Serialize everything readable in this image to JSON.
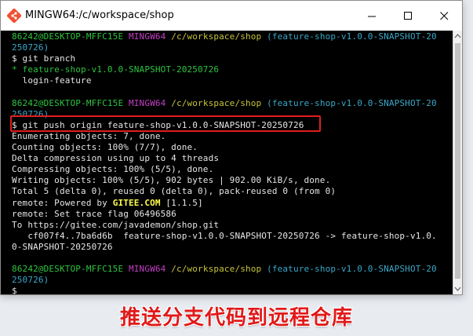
{
  "window": {
    "title": "MINGW64:/c/workspace/shop",
    "icon": "git-bash-icon",
    "controls": [
      "minimize-icon",
      "maximize-icon",
      "close-icon"
    ]
  },
  "terminal": {
    "lines": [
      {
        "segments": [
          {
            "text": "86242@DESKTOP-MFFC15E ",
            "color": "green"
          },
          {
            "text": "MINGW64 ",
            "color": "magenta"
          },
          {
            "text": "/c/workspace/shop ",
            "color": "yellow"
          },
          {
            "text": "(feature-shop-v1.0.0-SNAPSHOT-20",
            "color": "cyan"
          }
        ]
      },
      {
        "segments": [
          {
            "text": "250726)",
            "color": "cyan"
          }
        ]
      },
      {
        "segments": [
          {
            "text": "$ git branch",
            "color": "white"
          }
        ]
      },
      {
        "segments": [
          {
            "text": "* feature-shop-v1.0.0-SNAPSHOT-20250726",
            "color": "green"
          }
        ]
      },
      {
        "segments": [
          {
            "text": "  login-feature",
            "color": "white"
          }
        ]
      },
      {
        "segments": [
          {
            "text": "",
            "color": "white"
          }
        ]
      },
      {
        "segments": [
          {
            "text": "86242@DESKTOP-MFFC15E ",
            "color": "green"
          },
          {
            "text": "MINGW64 ",
            "color": "magenta"
          },
          {
            "text": "/c/workspace/shop ",
            "color": "yellow"
          },
          {
            "text": "(feature-shop-v1.0.0-SNAPSHOT-20",
            "color": "cyan"
          }
        ]
      },
      {
        "segments": [
          {
            "text": "250726)",
            "color": "cyan"
          }
        ]
      },
      {
        "segments": [
          {
            "text": "$ git push origin feature-shop-v1.0.0-SNAPSHOT-20250726",
            "color": "white"
          }
        ]
      },
      {
        "segments": [
          {
            "text": "Enumerating objects: 7, done.",
            "color": "white"
          }
        ]
      },
      {
        "segments": [
          {
            "text": "Counting objects: 100% (7/7), done.",
            "color": "white"
          }
        ]
      },
      {
        "segments": [
          {
            "text": "Delta compression using up to 4 threads",
            "color": "white"
          }
        ]
      },
      {
        "segments": [
          {
            "text": "Compressing objects: 100% (5/5), done.",
            "color": "white"
          }
        ]
      },
      {
        "segments": [
          {
            "text": "Writing objects: 100% (5/5), 902 bytes | 902.00 KiB/s, done.",
            "color": "white"
          }
        ]
      },
      {
        "segments": [
          {
            "text": "Total 5 (delta 0), reused 0 (delta 0), pack-reused 0 (from 0)",
            "color": "white"
          }
        ]
      },
      {
        "segments": [
          {
            "text": "remote: Powered by ",
            "color": "white"
          },
          {
            "text": "GITEE.COM",
            "color": "gitee"
          },
          {
            "text": " [1.1.5]",
            "color": "white"
          }
        ]
      },
      {
        "segments": [
          {
            "text": "remote: Set trace flag 06496586",
            "color": "white"
          }
        ]
      },
      {
        "segments": [
          {
            "text": "To https://gitee.com/javademon/shop.git",
            "color": "white"
          }
        ]
      },
      {
        "segments": [
          {
            "text": "   cf007f4..7ba6d6b  feature-shop-v1.0.0-SNAPSHOT-20250726 -> feature-shop-v1.0.",
            "color": "white"
          }
        ]
      },
      {
        "segments": [
          {
            "text": "0-SNAPSHOT-20250726",
            "color": "white"
          }
        ]
      },
      {
        "segments": [
          {
            "text": "",
            "color": "white"
          }
        ]
      },
      {
        "segments": [
          {
            "text": "86242@DESKTOP-MFFC15E ",
            "color": "green"
          },
          {
            "text": "MINGW64 ",
            "color": "magenta"
          },
          {
            "text": "/c/workspace/shop ",
            "color": "yellow"
          },
          {
            "text": "(feature-shop-v1.0.0-SNAPSHOT-20",
            "color": "cyan"
          }
        ]
      },
      {
        "segments": [
          {
            "text": "250726)",
            "color": "cyan"
          }
        ]
      },
      {
        "segments": [
          {
            "text": "$",
            "color": "white"
          }
        ]
      }
    ]
  },
  "caption": "推送分支代码到远程仓库",
  "colors": {
    "highlight_border": "#e01e1e",
    "caption": "#e11919",
    "terminal_bg": "#000000"
  }
}
